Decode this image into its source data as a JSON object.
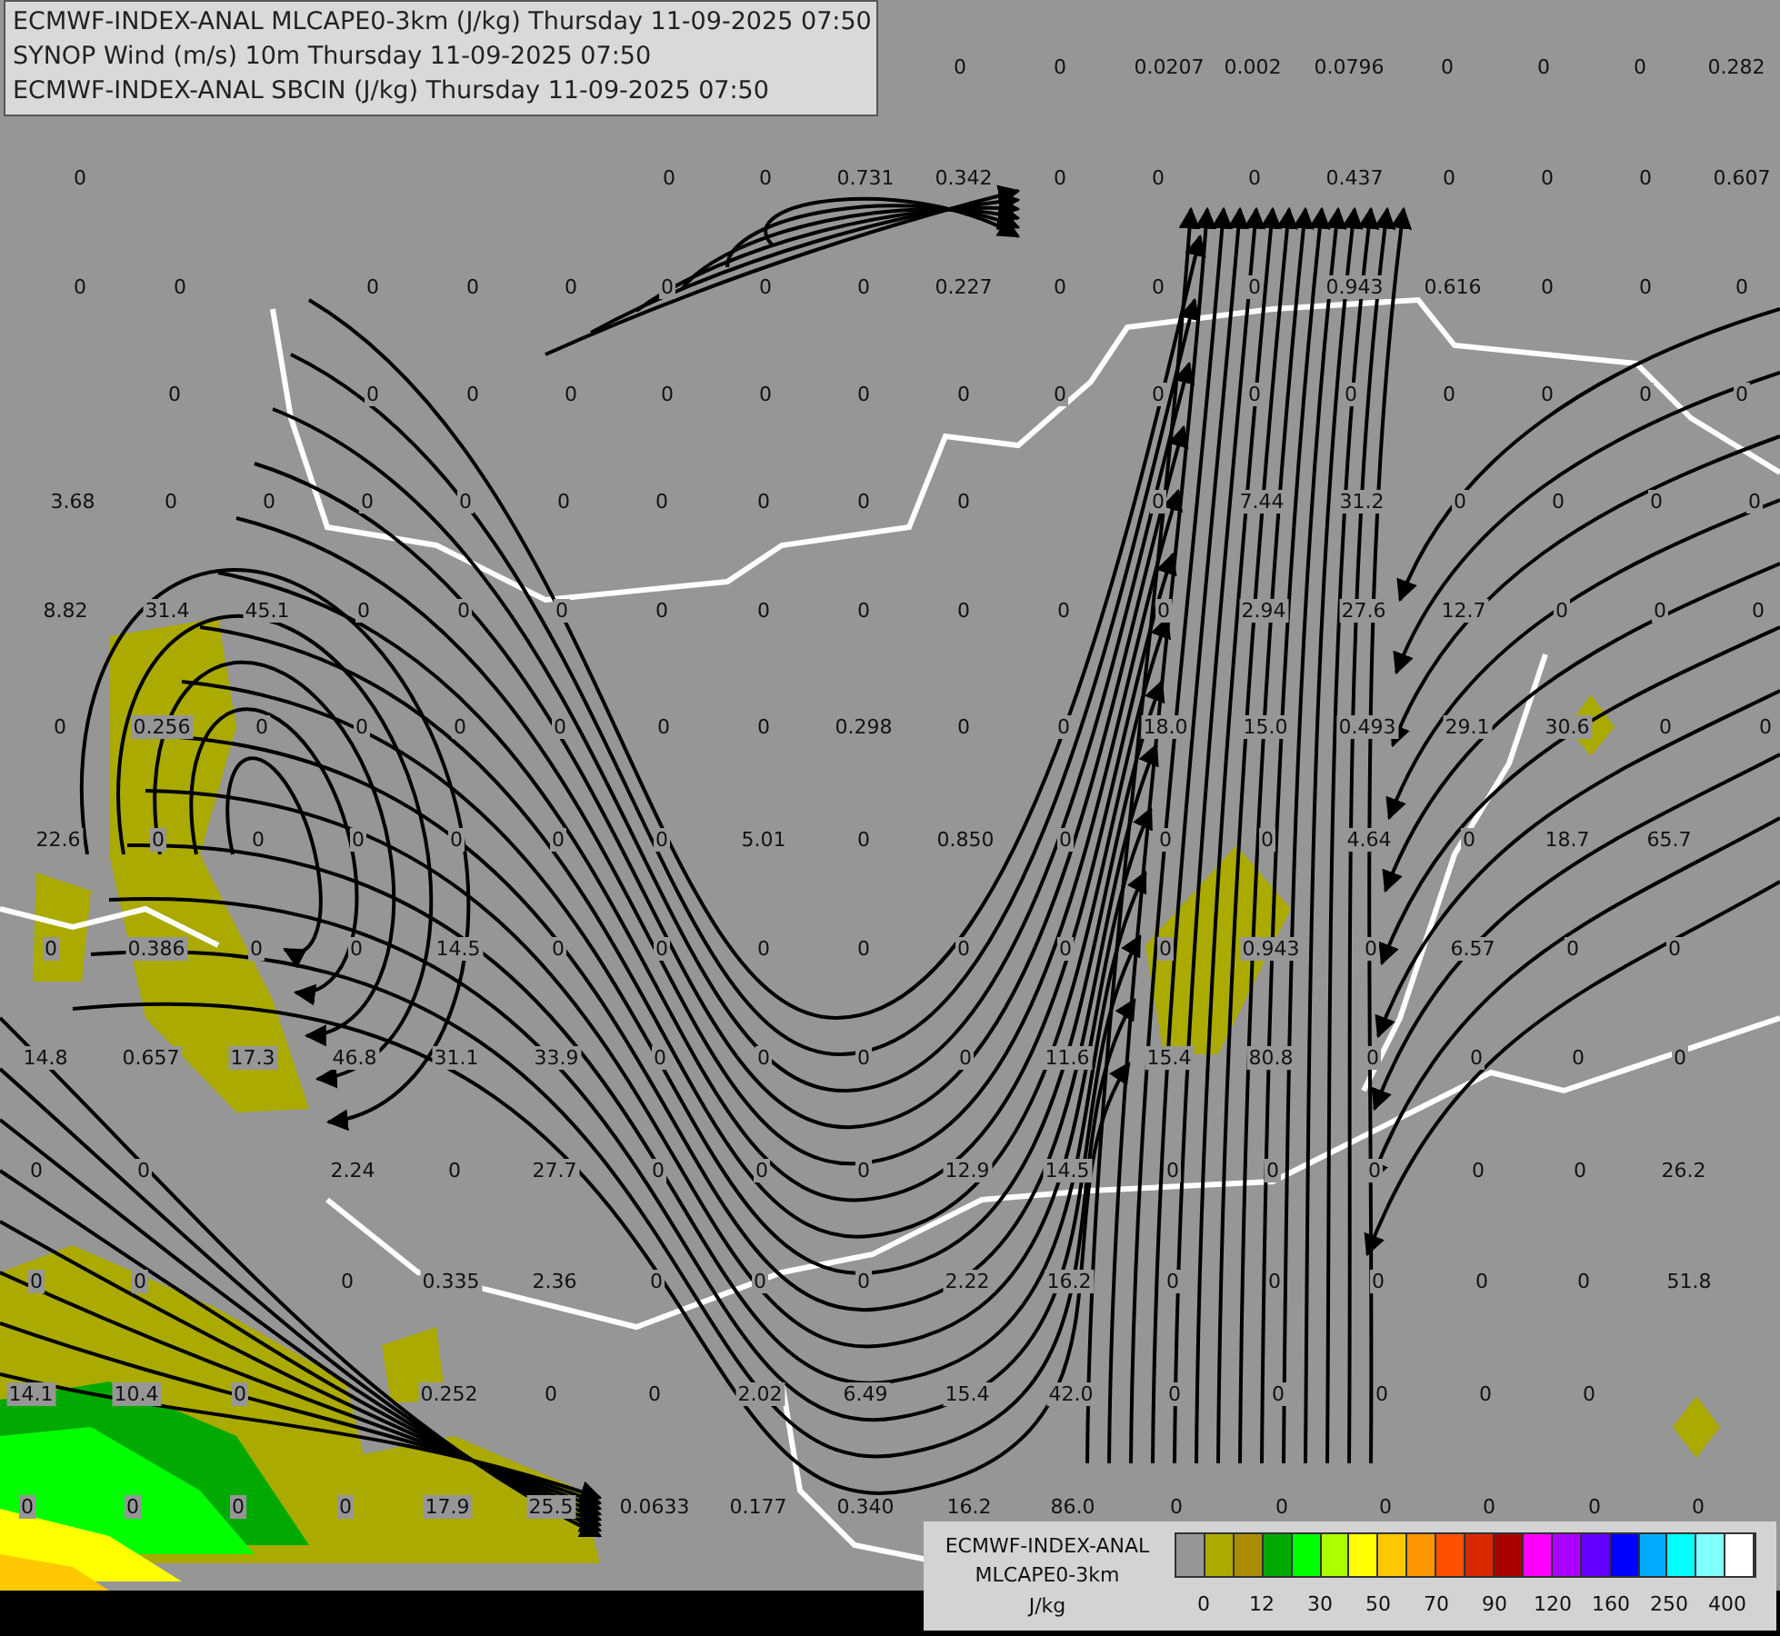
{
  "header": {
    "lines": [
      "ECMWF-INDEX-ANAL MLCAPE0-3km (J/kg) Thursday 11-09-2025 07:50",
      "SYNOP Wind (m/s) 10m Thursday 11-09-2025 07:50",
      "ECMWF-INDEX-ANAL SBCIN (J/kg) Thursday 11-09-2025 07:50"
    ]
  },
  "map": {
    "value_rows": [
      [
        "0",
        "0",
        "0.0207",
        "0.002",
        "0.0796",
        "0",
        "0",
        "0",
        "0.282"
      ],
      [
        "0",
        "0",
        "0",
        "0.731",
        "0.342",
        "0",
        "0",
        "0",
        "0.437",
        "0",
        "0",
        "0",
        "0.607"
      ],
      [
        "0",
        "0",
        "0",
        "0",
        "0",
        "0",
        "0",
        "0",
        "0.227",
        "0",
        "0",
        "0",
        "0.943",
        "0.616",
        "0",
        "0",
        "0"
      ],
      [
        "0",
        "0",
        "0",
        "0",
        "0",
        "0",
        "0",
        "0",
        "0",
        "0",
        "0",
        "0",
        "0",
        "0",
        "0",
        "0"
      ],
      [
        "3.68",
        "0",
        "0",
        "0",
        "0",
        "0",
        "0",
        "0",
        "0",
        "0",
        "0",
        "7.44",
        "31.2",
        "0",
        "0",
        "0",
        "0"
      ],
      [
        "8.82",
        "31.4",
        "45.1",
        "0",
        "0",
        "0",
        "0",
        "0",
        "0",
        "0",
        "0",
        "0",
        "2.94",
        "27.6",
        "12.7",
        "0",
        "0",
        "0"
      ],
      [
        "0",
        "0.256",
        "0",
        "0",
        "0",
        "0",
        "0",
        "0",
        "0.298",
        "0",
        "0",
        "18.0",
        "15.0",
        "0.493",
        "29.1",
        "30.6",
        "0",
        "0"
      ],
      [
        "22.6",
        "0",
        "0",
        "0",
        "0",
        "0",
        "0",
        "5.01",
        "0",
        "0.850",
        "0",
        "0",
        "0",
        "4.64",
        "0",
        "18.7",
        "65.7"
      ],
      [
        "0",
        "0.386",
        "0",
        "0",
        "14.5",
        "0",
        "0",
        "0",
        "0",
        "0",
        "0",
        "0",
        "0.943",
        "0",
        "6.57",
        "0",
        "0"
      ],
      [
        "14.8",
        "0.657",
        "17.3",
        "46.8",
        "31.1",
        "33.9",
        "0",
        "0",
        "0",
        "0",
        "11.6",
        "15.4",
        "80.8",
        "0",
        "0",
        "0",
        "0"
      ],
      [
        "0",
        "0",
        "2.24",
        "0",
        "27.7",
        "0",
        "0",
        "0",
        "12.9",
        "14.5",
        "0",
        "0",
        "0",
        "0",
        "0",
        "26.2"
      ],
      [
        "0",
        "0",
        "0",
        "0.335",
        "2.36",
        "0",
        "0",
        "0",
        "2.22",
        "16.2",
        "0",
        "0",
        "0",
        "0",
        "0",
        "51.8"
      ],
      [
        "14.1",
        "10.4",
        "0",
        "0.252",
        "0",
        "0",
        "2.02",
        "6.49",
        "15.4",
        "42.0",
        "0",
        "0",
        "0",
        "0",
        "0"
      ],
      [
        "0",
        "0",
        "0",
        "0",
        "17.9",
        "25.5",
        "0.0633",
        "0.177",
        "0.340",
        "16.2",
        "86.0",
        "0",
        "0",
        "0",
        "0",
        "0",
        "0"
      ]
    ]
  },
  "legend": {
    "title_lines": [
      "ECMWF-INDEX-ANAL",
      "MLCAPE0-3km"
    ],
    "unit": "J/kg",
    "bins": [
      {
        "color": "#969696"
      },
      {
        "color": "#aaaa00"
      },
      {
        "color": "#aa8c00"
      },
      {
        "color": "#00aa00"
      },
      {
        "color": "#00ff00"
      },
      {
        "color": "#aaff00"
      },
      {
        "color": "#ffff00"
      },
      {
        "color": "#ffc800"
      },
      {
        "color": "#ff9600"
      },
      {
        "color": "#ff5000"
      },
      {
        "color": "#d72800"
      },
      {
        "color": "#aa0000"
      },
      {
        "color": "#ff00ff"
      },
      {
        "color": "#aa00ff"
      },
      {
        "color": "#6400ff"
      },
      {
        "color": "#0000ff"
      },
      {
        "color": "#00aaff"
      },
      {
        "color": "#00ffff"
      },
      {
        "color": "#80ffff"
      },
      {
        "color": "#ffffff"
      }
    ],
    "ticks": [
      "0",
      "12",
      "30",
      "50",
      "70",
      "90",
      "120",
      "160",
      "250",
      "400"
    ]
  }
}
